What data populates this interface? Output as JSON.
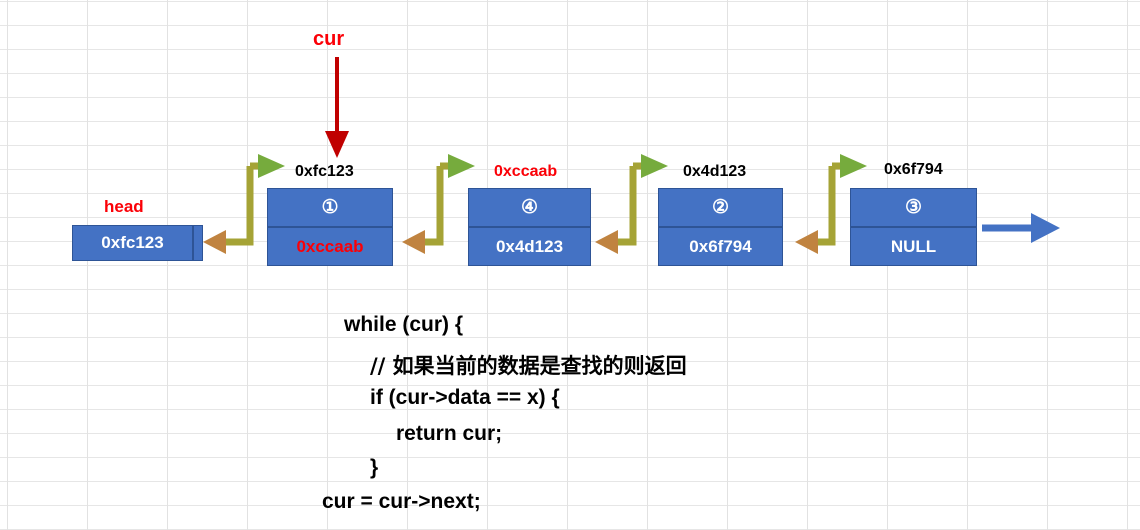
{
  "diagram": {
    "title_marker": "cur",
    "colors": {
      "node_fill": "#4472c4",
      "node_border": "#2e5496",
      "link_line": "#a5a336",
      "link_arrow_forward": "#76ab3d",
      "link_arrow_back": "#c08340",
      "cur_marker": "#c00000",
      "tail_arrow": "#4472c4",
      "red_text": "#fb0007",
      "black_text": "#000000",
      "grid": "#e2e2e2"
    },
    "head_pointer": {
      "label": "head",
      "value": "0xfc123"
    },
    "nodes": [
      {
        "address": "0xfc123",
        "address_color": "black",
        "index": "①",
        "next": "0xccaab",
        "next_color": "red"
      },
      {
        "address": "0xccaab",
        "address_color": "red",
        "index": "④",
        "next": "0x4d123",
        "next_color": "white"
      },
      {
        "address": "0x4d123",
        "address_color": "black",
        "index": "②",
        "next": "0x6f794",
        "next_color": "white"
      },
      {
        "address": "0x6f794",
        "address_color": "black",
        "index": "③",
        "next": "NULL",
        "next_color": "white"
      }
    ]
  },
  "code": {
    "lines": [
      "while (cur) {",
      "// 如果当前的数据是查找的则返回",
      "if (cur->data == x) {",
      "return cur;",
      "}",
      "cur = cur->next;"
    ]
  }
}
